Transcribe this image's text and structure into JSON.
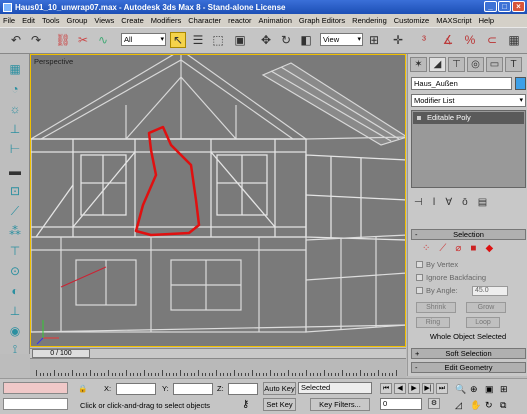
{
  "window": {
    "title": "Haus01_10_unwrap07.max - Autodesk 3ds Max 8 - Stand-alone License"
  },
  "menu": [
    "File",
    "Edit",
    "Tools",
    "Group",
    "Views",
    "Create",
    "Modifiers",
    "Character",
    "reactor",
    "Animation",
    "Graph Editors",
    "Rendering",
    "Customize",
    "MAXScript",
    "Help"
  ],
  "toolbar": {
    "selection_filter": "All",
    "reference_coord": "View",
    "icons": [
      "undo-icon",
      "redo-icon",
      "select-link-icon",
      "unlink-icon",
      "bind-spacewarp-icon",
      "select-object-icon",
      "select-by-name-icon",
      "rectangular-selection-icon",
      "window-crossing-icon",
      "select-move-icon",
      "select-rotate-icon",
      "select-scale-icon",
      "pivot-icon",
      "select-manipulate-icon",
      "snaps-icon",
      "angle-snap-icon",
      "percent-snap-icon",
      "spinner-snap-icon"
    ]
  },
  "left_toolbar": {
    "icons": [
      "create-geometry-icon",
      "shapes-icon",
      "lights-icon",
      "cameras-icon",
      "helpers-icon",
      "spacewarps-icon",
      "systems-icon",
      "modifiers-icon",
      "particles-icon",
      "hierarchy-icon",
      "motion-icon",
      "display-icon",
      "utilities-icon",
      "render-icon",
      "reactor-icon",
      "camera-tools-icon"
    ]
  },
  "viewport": {
    "label": "Perspective"
  },
  "command_panel": {
    "object_name": "Haus_Außen",
    "object_color": "#3ea0e8",
    "modifier_list": "Modifier List",
    "stack_item": "Editable Poly",
    "selection_rollout": "Selection",
    "by_vertex": "By Vertex",
    "ignore_backfacing": "Ignore Backfacing",
    "by_angle": "By Angle:",
    "angle_value": "45.0",
    "shrink": "Shrink",
    "grow": "Grow",
    "ring": "Ring",
    "loop": "Loop",
    "selection_status": "Whole Object Selected",
    "soft_selection": "Soft Selection",
    "edit_geometry": "Edit Geometry"
  },
  "timeline": {
    "frame_display": "0 / 100",
    "ticks": [
      "0",
      "5",
      "10",
      "15",
      "20",
      "25",
      "30",
      "35",
      "40",
      "45",
      "50",
      "55",
      "60",
      "65",
      "70",
      "75",
      "80",
      "85",
      "90",
      "95",
      "100"
    ]
  },
  "status": {
    "x_label": "X:",
    "y_label": "Y:",
    "z_label": "Z:",
    "auto_key": "Auto Key",
    "set_key": "Set Key",
    "key_mode": "Selected",
    "key_filters": "Key Filters...",
    "prompt": "Click or click-and-drag to select objects",
    "frame": "0"
  }
}
